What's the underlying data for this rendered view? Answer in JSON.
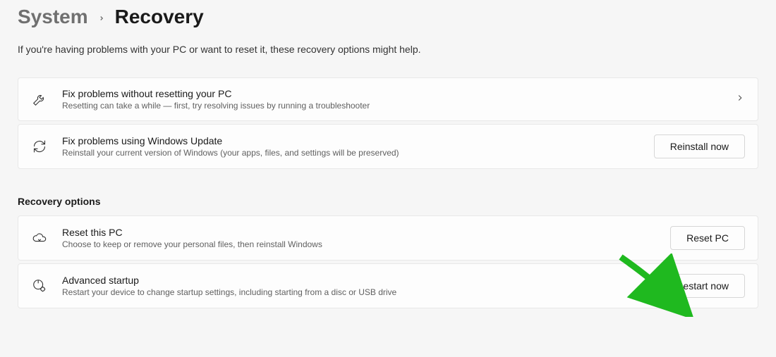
{
  "breadcrumb": {
    "parent": "System",
    "current": "Recovery"
  },
  "page_description": "If you're having problems with your PC or want to reset it, these recovery options might help.",
  "fix_section": {
    "troubleshoot": {
      "title": "Fix problems without resetting your PC",
      "subtitle": "Resetting can take a while — first, try resolving issues by running a troubleshooter"
    },
    "win_update": {
      "title": "Fix problems using Windows Update",
      "subtitle": "Reinstall your current version of Windows (your apps, files, and settings will be preserved)",
      "button": "Reinstall now"
    }
  },
  "recovery_section": {
    "header": "Recovery options",
    "reset_pc": {
      "title": "Reset this PC",
      "subtitle": "Choose to keep or remove your personal files, then reinstall Windows",
      "button": "Reset PC"
    },
    "advanced_startup": {
      "title": "Advanced startup",
      "subtitle": "Restart your device to change startup settings, including starting from a disc or USB drive",
      "button": "Restart now"
    }
  }
}
